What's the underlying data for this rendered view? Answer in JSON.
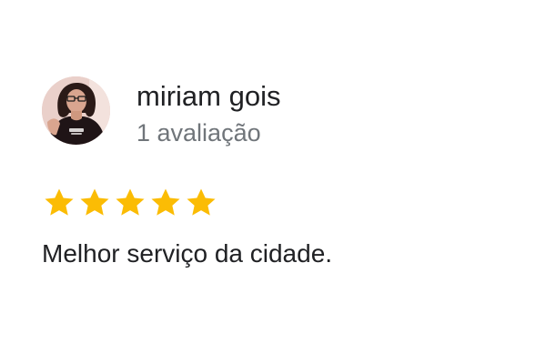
{
  "review": {
    "reviewer_name": "miriam gois",
    "review_count": "1 avaliação",
    "rating": 5,
    "rating_max": 5,
    "review_text": "Melhor serviço da cidade.",
    "star_color": "#fbbc04"
  }
}
